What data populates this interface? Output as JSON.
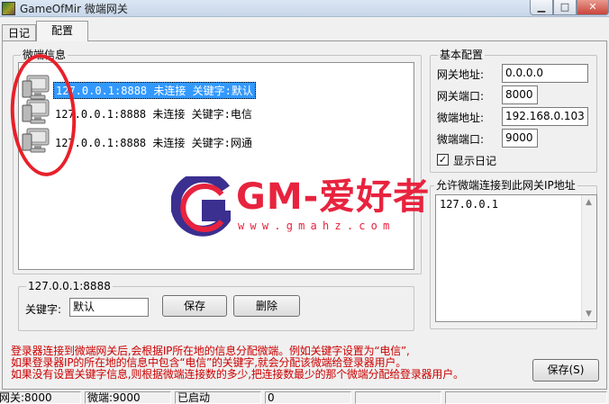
{
  "window": {
    "app_name": "GameOfMir",
    "subtitle": "微端网关",
    "min_icon": "▁",
    "max_icon": "□",
    "close_icon": "✕"
  },
  "tabs": [
    {
      "label": "日记",
      "active": false
    },
    {
      "label": "配置",
      "active": true
    }
  ],
  "gateway_info": {
    "group_label": "微端信息",
    "items": [
      {
        "ip": "127.0.0.1",
        "port": "8888",
        "status": "未连接",
        "keyword_label": "关键字",
        "keyword": "默认",
        "text": "127.0.0.1:8888 未连接 关键字:默认",
        "selected": true
      },
      {
        "ip": "127.0.0.1",
        "port": "8888",
        "status": "未连接",
        "keyword_label": "关键字",
        "keyword": "电信",
        "text": "127.0.0.1:8888 未连接 关键字:电信",
        "selected": false
      },
      {
        "ip": "127.0.0.1",
        "port": "8888",
        "status": "未连接",
        "keyword_label": "关键字",
        "keyword": "网通",
        "text": "127.0.0.1:8888 未连接 关键字:网通",
        "selected": false
      }
    ]
  },
  "edit_group": {
    "group_label": "127.0.0.1:8888",
    "keyword_label": "关键字:",
    "keyword_value": "默认",
    "save_label": "保存",
    "delete_label": "删除"
  },
  "basic_config": {
    "group_label": "基本配置",
    "gateway_addr_label": "网关地址:",
    "gateway_addr_value": "0.0.0.0",
    "gateway_port_label": "网关端口:",
    "gateway_port_value": "8000",
    "micro_addr_label": "微端地址:",
    "micro_addr_value": "192.168.0.103",
    "micro_port_label": "微端端口:",
    "micro_port_value": "9000",
    "show_log_label": "显示日记",
    "show_log_checked": true,
    "check_mark": "✓"
  },
  "allowed_ips": {
    "group_label": "允许微端连接到此网关IP地址",
    "items": [
      "127.0.0.1"
    ],
    "scroll_up": "▲",
    "scroll_down": "▼"
  },
  "hints": [
    "登录器连接到微端网关后,会根据IP所在地的信息分配微端。例如关键字设置为“电信”,",
    "如果登录器IP的所在地的信息中包含“电信”的关键字,就会分配该微端给登录器用户。",
    "如果没有设置关键字信息,则根据微端连接数的多少,把连接数最少的那个微端分配给登录器用户。"
  ],
  "save_main_label": "保存(S)",
  "status_bar": [
    "网关:8000",
    "微端:9000",
    "已启动",
    "0",
    "",
    ""
  ],
  "watermark": {
    "logo_letter": "G",
    "title": "GM-爱好者",
    "url": "www.gmahz.com",
    "color": "#e8233e",
    "accent": "#3b2f8f"
  },
  "colors": {
    "selection": "#3399ff",
    "hint_text": "#cc0000",
    "annotation": "#e8202a"
  },
  "icons": {
    "gateway_item": "computer-icon"
  }
}
